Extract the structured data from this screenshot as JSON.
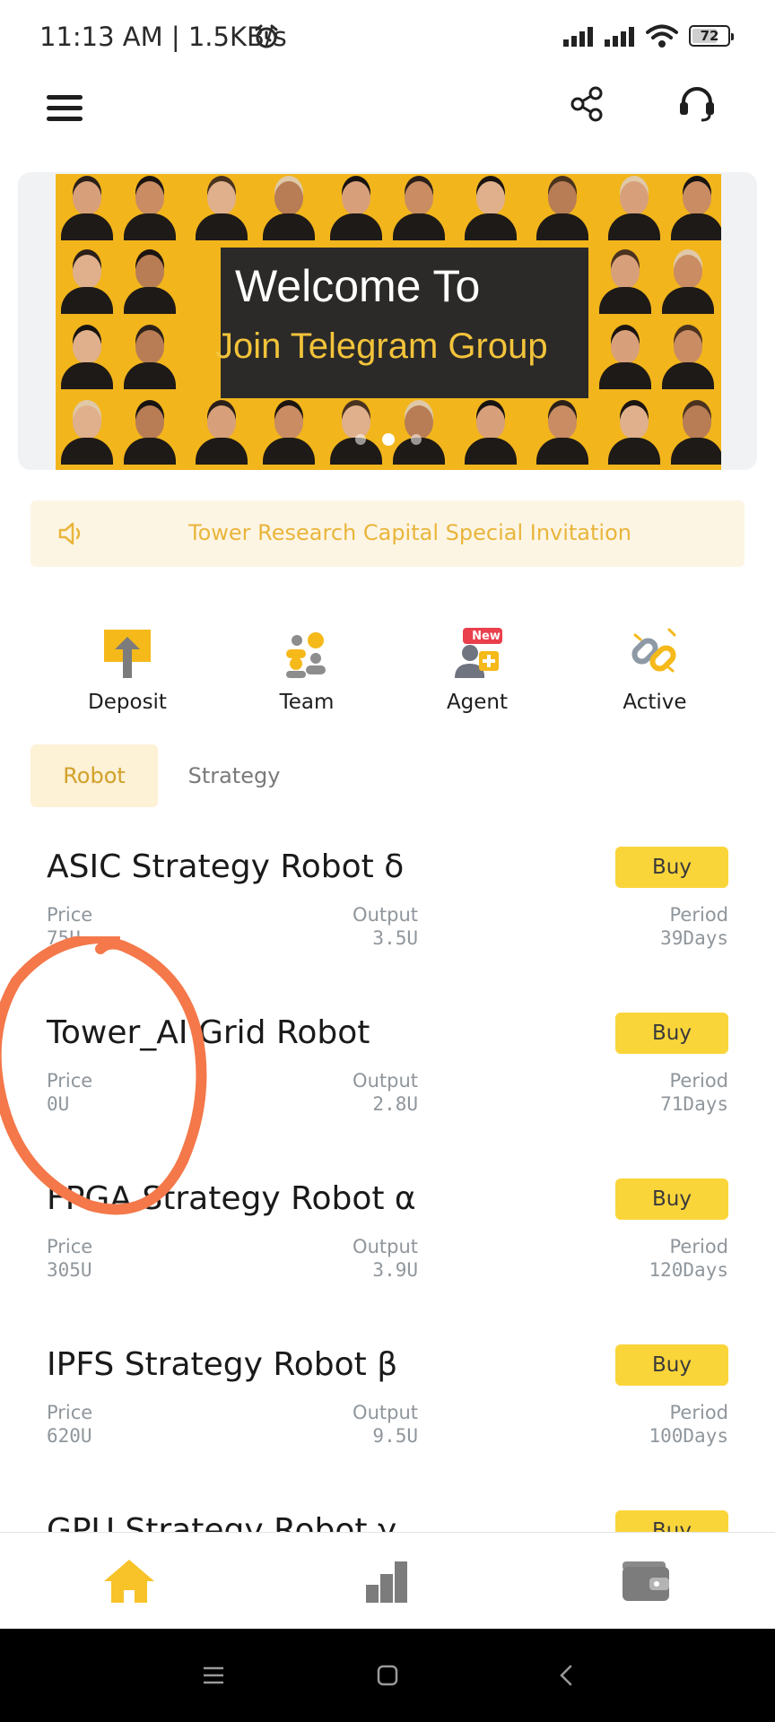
{
  "status": {
    "time_speed": "11:13 AM | 1.5KB/s",
    "battery": "72",
    "battery_level": 0.72
  },
  "banner": {
    "title": "Welcome To",
    "subtitle": "Join Telegram Group",
    "slides": 3,
    "active_slide": 2
  },
  "notice": {
    "text": "Tower Research Capital Special Invitation"
  },
  "quick_actions": [
    {
      "label": "Deposit",
      "icon": "deposit-icon"
    },
    {
      "label": "Team",
      "icon": "team-icon"
    },
    {
      "label": "Agent",
      "icon": "agent-icon",
      "badge": "New"
    },
    {
      "label": "Active",
      "icon": "active-icon"
    }
  ],
  "tabs": [
    {
      "label": "Robot",
      "active": true
    },
    {
      "label": "Strategy",
      "active": false
    }
  ],
  "labels": {
    "price": "Price",
    "output": "Output",
    "period": "Period",
    "buy": "Buy"
  },
  "robots": [
    {
      "name": "ASIC Strategy Robot δ",
      "price": "75U",
      "output": "3.5U",
      "period": "39Days"
    },
    {
      "name": "Tower_AI Grid Robot",
      "price": "0U",
      "output": "2.8U",
      "period": "71Days"
    },
    {
      "name": "FPGA Strategy Robot α",
      "price": "305U",
      "output": "3.9U",
      "period": "120Days"
    },
    {
      "name": "IPFS Strategy Robot β",
      "price": "620U",
      "output": "9.5U",
      "period": "100Days"
    },
    {
      "name": "GPU Strategy Robot γ",
      "price": "",
      "output": "",
      "period": ""
    }
  ],
  "bottom_nav": [
    {
      "icon": "home-icon",
      "active": true
    },
    {
      "icon": "chart-icon",
      "active": false
    },
    {
      "icon": "wallet-icon",
      "active": false
    }
  ],
  "colors": {
    "accent": "#fad53a",
    "accent_text": "#d1a12a",
    "notice_bg": "#fdf5e4",
    "annotation": "#f4784a"
  }
}
